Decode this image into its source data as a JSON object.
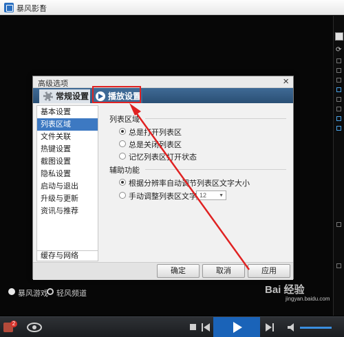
{
  "app": {
    "title": "暴风影音"
  },
  "dialog": {
    "title": "高级选项",
    "tabs": [
      {
        "label": "常规设置",
        "icon": "gear-icon"
      },
      {
        "label": "播放设置",
        "icon": "play-circle-icon"
      }
    ],
    "sidebar": [
      {
        "label": "基本设置",
        "active": false
      },
      {
        "label": "列表区域",
        "active": true
      },
      {
        "label": "文件关联",
        "active": false
      },
      {
        "label": "热键设置",
        "active": false
      },
      {
        "label": "截图设置",
        "active": false
      },
      {
        "label": "隐私设置",
        "active": false
      },
      {
        "label": "启动与退出",
        "active": false
      },
      {
        "label": "升级与更新",
        "active": false
      },
      {
        "label": "资讯与推荐",
        "active": false
      }
    ],
    "sidebar_bottom": "缓存与网络",
    "list_section": {
      "title": "列表区域",
      "options": [
        {
          "label": "总是打开列表区",
          "selected": true
        },
        {
          "label": "总是关闭列表区",
          "selected": false
        },
        {
          "label": "记忆列表区打开状态",
          "selected": false
        }
      ]
    },
    "aux_section": {
      "title": "辅助功能",
      "options": [
        {
          "label": "根据分辨率自动调节列表区文字大小",
          "selected": true
        },
        {
          "label": "手动调整列表区文字大小",
          "selected": false
        }
      ],
      "font_size_value": "12"
    },
    "buttons": {
      "ok": "确定",
      "cancel": "取消",
      "apply": "应用"
    }
  },
  "extras": {
    "games": "暴风游戏",
    "channel": "轻风频道"
  },
  "controlbar": {
    "badge_count": "2"
  },
  "watermark": {
    "text": "Bai 经验",
    "sub": "jingyan.baidu.com"
  },
  "colors": {
    "accent": "#3d79c2",
    "annotation": "#e02222",
    "tabbar": "#3f6a95",
    "play_button": "#1a63b8"
  }
}
